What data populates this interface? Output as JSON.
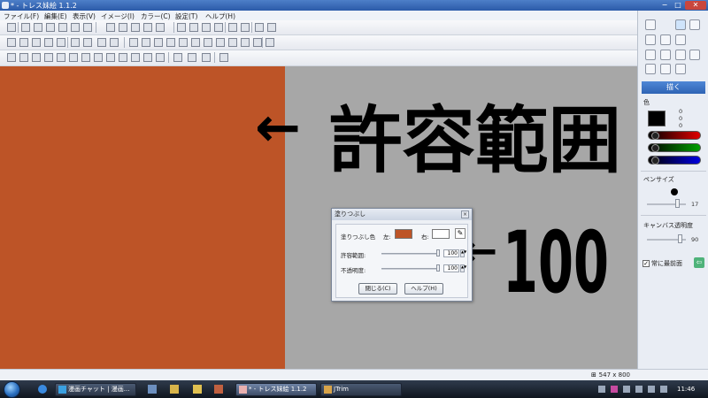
{
  "window": {
    "title": "* - トレス妹絵 1.1.2",
    "min_label": "−",
    "max_label": "□",
    "close_label": "✕"
  },
  "menu": [
    "ファイル(F)",
    "編集(E)",
    "表示(V)",
    "イメージ(I)",
    "カラー(C)",
    "設定(T)",
    "ヘルプ(H)"
  ],
  "colors": {
    "fill": "#bd5427",
    "canvas_bg": "#a7a7a7",
    "primary": "#000000",
    "red": "#c00000",
    "green": "#007000",
    "blue": "#0000b0"
  },
  "annotations": {
    "arrow1": "←",
    "text1": "許容範囲",
    "arrow2": "←",
    "text2": "100"
  },
  "dialog": {
    "title": "塗りつぶし",
    "close": "×",
    "fill_color_label": "塗りつぶし色",
    "left_label": "左:",
    "right_label": "右:",
    "tolerance_label": "許容範囲:",
    "tolerance_value": "100",
    "opacity_label": "不透明度:",
    "opacity_value": "100",
    "close_button": "閉じる(C)",
    "help_button": "ヘルプ(H)"
  },
  "sidebar": {
    "draw_button": "描く",
    "color_label": "色",
    "rgb": [
      "0",
      "0",
      "0"
    ],
    "pen_size_label": "ペンサイズ",
    "pen_size_value": "17",
    "canvas_opacity_label": "キャンバス透明度",
    "canvas_opacity_value": "90",
    "always_on_top_label": "常に最前面",
    "always_on_top_checked": true
  },
  "status": {
    "size": "547 x 800"
  },
  "taskbar": {
    "items": [
      "漫画チャット | 漫画...",
      "* - トレス妹絵 1.1.2",
      "JTrim"
    ],
    "clock": "11:46"
  }
}
